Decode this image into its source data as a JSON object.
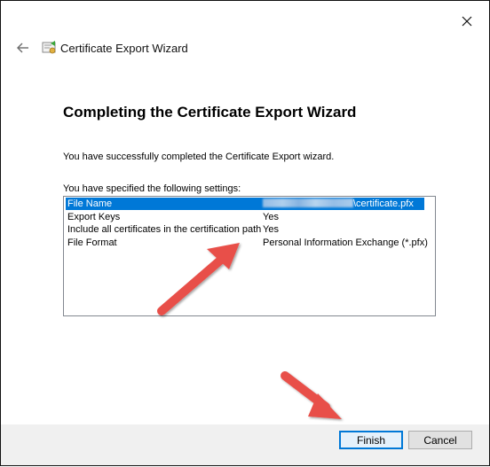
{
  "window": {
    "title": "Certificate Export Wizard"
  },
  "icons": {
    "close": "close-icon",
    "back": "back-arrow-icon",
    "wizard": "certificate-wizard-icon"
  },
  "main": {
    "heading": "Completing the Certificate Export Wizard",
    "success_message": "You have successfully completed the Certificate Export wizard.",
    "specified_label": "You have specified the following settings:"
  },
  "settings": {
    "rows": [
      {
        "key": "File Name",
        "value": "\\certificate.pfx",
        "selected": true
      },
      {
        "key": "Export Keys",
        "value": "Yes",
        "selected": false
      },
      {
        "key": "Include all certificates in the certification path",
        "value": "Yes",
        "selected": false
      },
      {
        "key": "File Format",
        "value": "Personal Information Exchange (*.pfx)",
        "selected": false
      }
    ]
  },
  "footer": {
    "finish_label": "Finish",
    "cancel_label": "Cancel"
  },
  "colors": {
    "selection": "#0078d7",
    "annotation_arrow": "#e8504a"
  }
}
